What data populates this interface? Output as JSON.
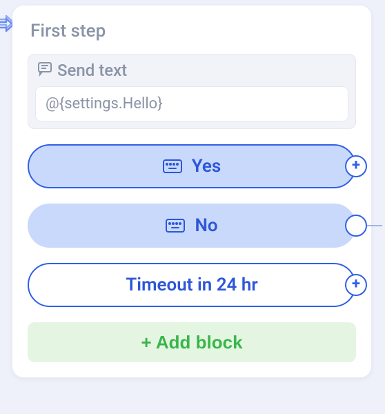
{
  "card": {
    "title": "First step"
  },
  "send_block": {
    "header_label": "Send text",
    "input_value": "@{settings.Hello}"
  },
  "choices": {
    "yes_label": "Yes",
    "no_label": "No"
  },
  "timeout": {
    "label": "Timeout in 24 hr"
  },
  "add_block": {
    "label": "+ Add block"
  },
  "icons": {
    "send_text": "message-icon",
    "keyboard": "keyboard-icon",
    "port_plus": "plus-icon",
    "port_empty": "circle-icon",
    "arrow_in": "arrow-in-icon"
  }
}
